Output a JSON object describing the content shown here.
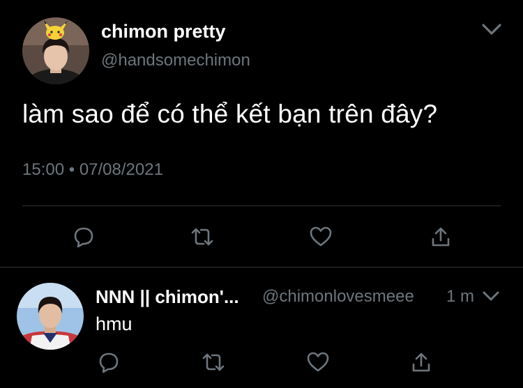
{
  "colors": {
    "background": "#000000",
    "primary_text": "#ffffff",
    "secondary_text": "#6e767d",
    "divider": "#2f3336",
    "icon": "#6e767d"
  },
  "tweet": {
    "author": {
      "display_name": "chimon pretty",
      "handle": "@handsomechimon",
      "avatar_icon": "profile-photo"
    },
    "text": "làm sao để có thể kết bạn trên đây?",
    "time": "15:00",
    "separator": "•",
    "date": "07/08/2021",
    "actions": [
      {
        "name": "reply",
        "icon": "speech-bubble-icon"
      },
      {
        "name": "retweet",
        "icon": "retweet-icon"
      },
      {
        "name": "like",
        "icon": "heart-icon"
      },
      {
        "name": "share",
        "icon": "share-icon"
      }
    ]
  },
  "reply": {
    "author": {
      "display_name": "NNN || chimon'...",
      "handle": "@chimonlovesmeee",
      "avatar_icon": "profile-photo"
    },
    "time_ago": "1 m",
    "text": "hmu",
    "actions": [
      {
        "name": "reply",
        "icon": "speech-bubble-icon"
      },
      {
        "name": "retweet",
        "icon": "retweet-icon"
      },
      {
        "name": "like",
        "icon": "heart-icon"
      },
      {
        "name": "share",
        "icon": "share-icon"
      }
    ]
  }
}
